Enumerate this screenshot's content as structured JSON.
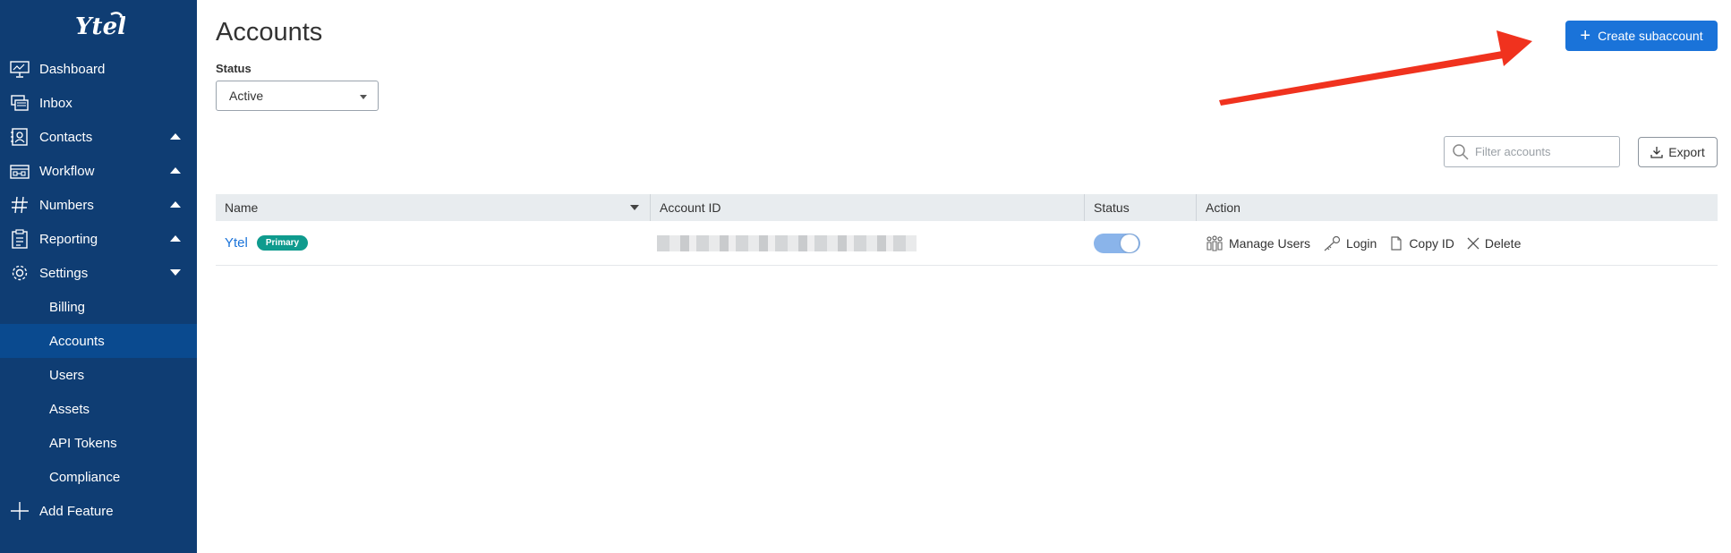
{
  "brand": {
    "logo_text": "Ytel"
  },
  "sidebar": {
    "items": [
      {
        "label": "Dashboard",
        "icon": "dashboard-icon"
      },
      {
        "label": "Inbox",
        "icon": "inbox-icon"
      },
      {
        "label": "Contacts",
        "icon": "contacts-icon",
        "expanded": false
      },
      {
        "label": "Workflow",
        "icon": "workflow-icon",
        "expanded": false
      },
      {
        "label": "Numbers",
        "icon": "hash-icon",
        "expanded": false
      },
      {
        "label": "Reporting",
        "icon": "reporting-icon",
        "expanded": false
      },
      {
        "label": "Settings",
        "icon": "gear-icon",
        "expanded": true
      }
    ],
    "settings_sub": [
      "Billing",
      "Accounts",
      "Users",
      "Assets",
      "API Tokens",
      "Compliance"
    ],
    "active_sub": "Accounts",
    "add_feature": "Add Feature"
  },
  "page": {
    "title": "Accounts",
    "status_label": "Status",
    "status_value": "Active",
    "create_button": "Create subaccount",
    "filter_placeholder": "Filter accounts",
    "export_button": "Export"
  },
  "table": {
    "columns": [
      "Name",
      "Account ID",
      "Status",
      "Action"
    ],
    "rows": [
      {
        "name": "Ytel",
        "badge": "Primary",
        "status_on": true,
        "actions": [
          "Manage Users",
          "Login",
          "Copy ID",
          "Delete"
        ]
      }
    ]
  },
  "colors": {
    "sidebar_bg": "#0f3d73",
    "sidebar_active": "#0a4a8f",
    "primary_button": "#1a73d9",
    "badge": "#0f9b8e",
    "annotation_arrow": "#f0321e"
  }
}
